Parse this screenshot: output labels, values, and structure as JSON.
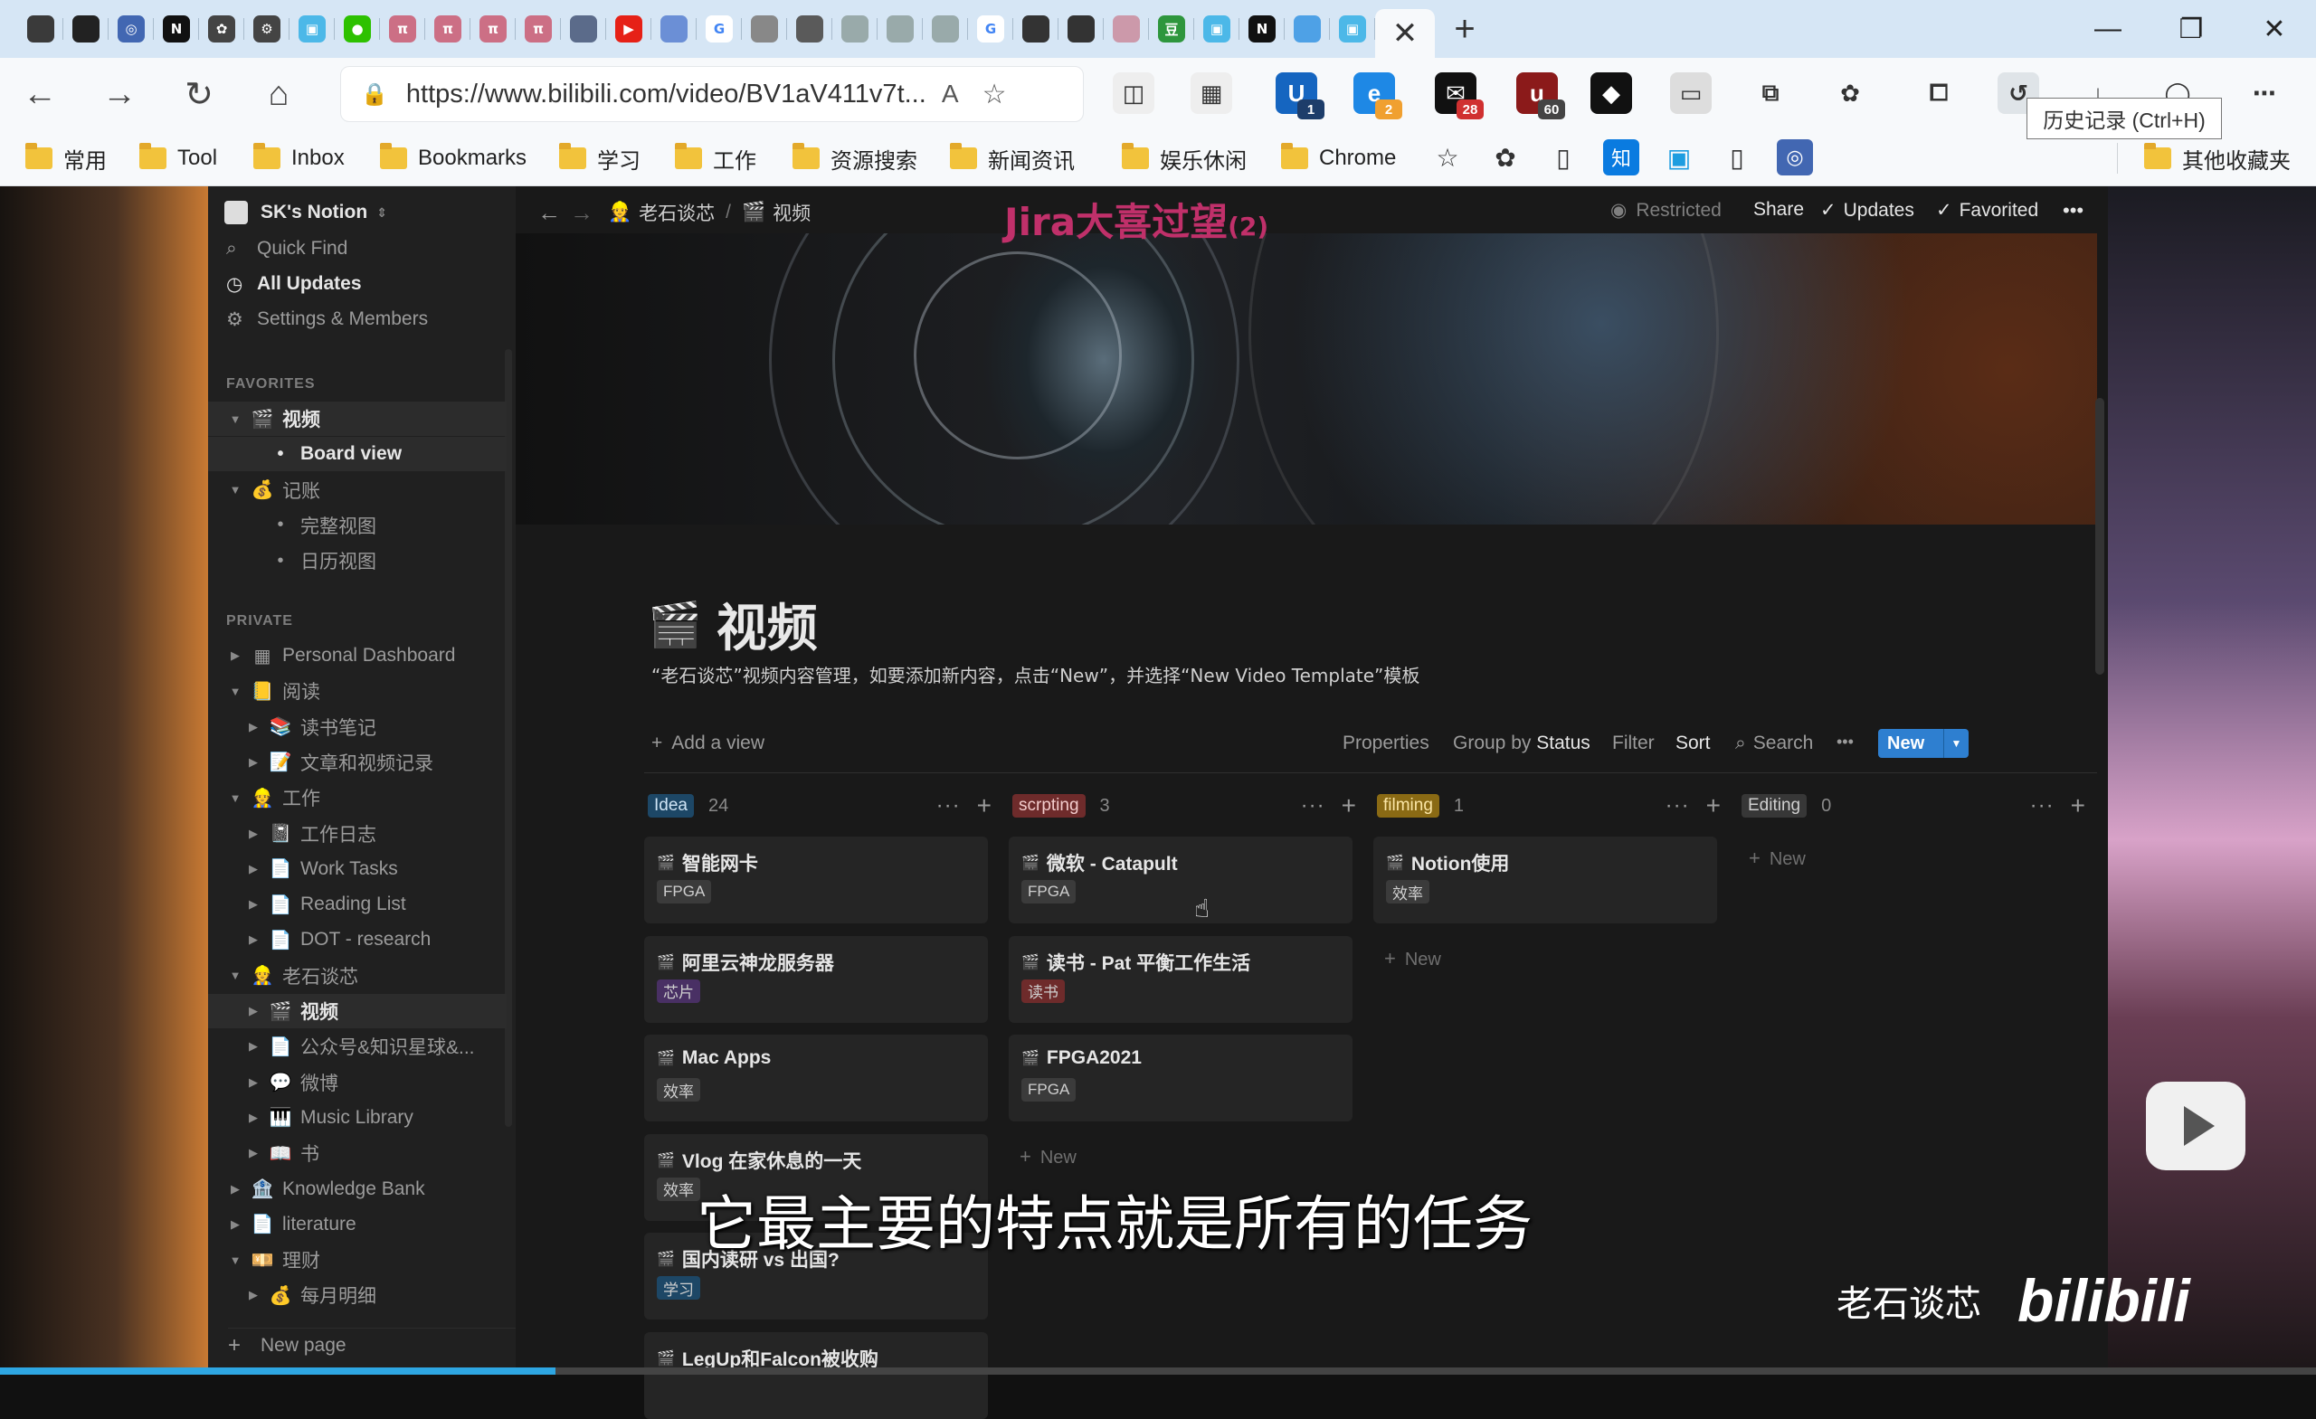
{
  "browser": {
    "url": "https://www.bilibili.com/video/BV1aV411v7t...",
    "tooltip": "历史记录 (Ctrl+H)",
    "read_aloud_label": "A",
    "extension_badges": {
      "bookmark": "1",
      "edge": "2",
      "mail": "28",
      "ublock": "60"
    },
    "bookmarks": [
      "常用",
      "Tool",
      "Inbox",
      "Bookmarks",
      "学习",
      "工作",
      "资源搜索",
      "新闻资讯",
      "娱乐休闲",
      "Chrome"
    ],
    "other_bookmarks": "其他收藏夹",
    "tab_icons": [
      "sidebar-icon",
      "mixer-icon",
      "rss-icon",
      "notion-icon",
      "gear-icon",
      "settings-icon",
      "bilibili-icon",
      "wechat-icon",
      "pi-icon",
      "pi-icon",
      "pi-icon",
      "pi-icon",
      "paw-icon",
      "youtube-icon",
      "translate-icon",
      "google-icon",
      "book-icon",
      "tools-icon",
      "chat-icon",
      "chat-icon",
      "chat-icon",
      "google-icon",
      "ifttt-icon",
      "ifttt-icon",
      "pic-icon",
      "douban-icon",
      "bilibili-icon",
      "notion-icon",
      "cloud-icon",
      "bilibili-icon"
    ]
  },
  "notion": {
    "workspace": "SK's Notion",
    "quick_find": "Quick Find",
    "all_updates": "All Updates",
    "settings": "Settings & Members",
    "favorites_label": "FAVORITES",
    "private_label": "PRIVATE",
    "favorites": [
      {
        "label": "视频",
        "emoji": "🎬",
        "level": 0,
        "caret": "▼",
        "bold": true
      },
      {
        "label": "Board view",
        "emoji": "•",
        "level": 1,
        "caret": "",
        "bold": true
      },
      {
        "label": "记账",
        "emoji": "💰",
        "level": 0,
        "caret": "▼"
      },
      {
        "label": "完整视图",
        "emoji": "•",
        "level": 1,
        "caret": ""
      },
      {
        "label": "日历视图",
        "emoji": "•",
        "level": 1,
        "caret": ""
      }
    ],
    "private": [
      {
        "label": "Personal Dashboard",
        "emoji": "▦",
        "level": 0,
        "caret": "▶"
      },
      {
        "label": "阅读",
        "emoji": "📒",
        "level": 0,
        "caret": "▼"
      },
      {
        "label": "读书笔记",
        "emoji": "📚",
        "level": 1,
        "caret": "▶"
      },
      {
        "label": "文章和视频记录",
        "emoji": "📝",
        "level": 1,
        "caret": "▶"
      },
      {
        "label": "工作",
        "emoji": "👷",
        "level": 0,
        "caret": "▼"
      },
      {
        "label": "工作日志",
        "emoji": "📓",
        "level": 1,
        "caret": "▶"
      },
      {
        "label": "Work Tasks",
        "emoji": "📄",
        "level": 1,
        "caret": "▶"
      },
      {
        "label": "Reading List",
        "emoji": "📄",
        "level": 1,
        "caret": "▶"
      },
      {
        "label": "DOT - research",
        "emoji": "📄",
        "level": 1,
        "caret": "▶"
      },
      {
        "label": "老石谈芯",
        "emoji": "👷",
        "level": 0,
        "caret": "▼"
      },
      {
        "label": "视频",
        "emoji": "🎬",
        "level": 1,
        "caret": "▶",
        "selected": true
      },
      {
        "label": "公众号&知识星球&...",
        "emoji": "📄",
        "level": 1,
        "caret": "▶"
      },
      {
        "label": "微博",
        "emoji": "💬",
        "level": 1,
        "caret": "▶"
      },
      {
        "label": "Music Library",
        "emoji": "🎹",
        "level": 1,
        "caret": "▶"
      },
      {
        "label": "书",
        "emoji": "📖",
        "level": 1,
        "caret": "▶"
      },
      {
        "label": "Knowledge Bank",
        "emoji": "🏦",
        "level": 0,
        "caret": "▶"
      },
      {
        "label": "literature",
        "emoji": "📄",
        "level": 0,
        "caret": "▶"
      },
      {
        "label": "理财",
        "emoji": "💴",
        "level": 0,
        "caret": "▼"
      },
      {
        "label": "每月明细",
        "emoji": "💰",
        "level": 1,
        "caret": "▶"
      }
    ],
    "new_page": "New page",
    "breadcrumb": [
      {
        "emoji": "👷",
        "label": "老石谈芯"
      },
      {
        "emoji": "🎬",
        "label": "视频"
      }
    ],
    "breadcrumb_sep": "/",
    "topbar": {
      "restricted": "Restricted",
      "share": "Share",
      "updates": "Updates",
      "favorited": "Favorited",
      "more": "•••"
    },
    "page_title": "视频",
    "page_emoji": "🎬",
    "description": "“老石谈芯”视频内容管理，如要添加新内容，点击“New”，并选择“New Video Template”模板",
    "toolbar": {
      "add_view": "Add a view",
      "properties": "Properties",
      "group_by": "Group by",
      "group_value": "Status",
      "filter": "Filter",
      "sort": "Sort",
      "search": "Search",
      "more": "•••",
      "new": "New"
    },
    "new_label": "New",
    "columns": [
      {
        "name": "Idea",
        "count": "24",
        "bg": "#1d4766",
        "fg": "#cfe4f5",
        "cards": [
          {
            "title": "智能网卡",
            "tag": "FPGA",
            "tag_bg": "#3b3b3b"
          },
          {
            "title": "阿里云神龙服务器",
            "tag": "芯片",
            "tag_bg": "#493064"
          },
          {
            "title": "Mac Apps",
            "tag": "效率",
            "tag_bg": "#3b3b3b"
          },
          {
            "title": "Vlog 在家休息的一天",
            "tag": "效率",
            "tag_bg": "#3b3b3b"
          },
          {
            "title": "国内读研 vs 出国?",
            "tag": "学习",
            "tag_bg": "#1d4766"
          },
          {
            "title": "LegUp和Falcon被收购",
            "tag": "",
            "tag_bg": "#3b3b3b"
          }
        ]
      },
      {
        "name": "scrpting",
        "count": "3",
        "bg": "#6e2b2b",
        "fg": "#f2cccc",
        "cards": [
          {
            "title": "微软 - Catapult",
            "tag": "FPGA",
            "tag_bg": "#3b3b3b"
          },
          {
            "title": "读书 - Pat 平衡工作生活",
            "tag": "读书",
            "tag_bg": "#6e2b2b"
          },
          {
            "title": "FPGA2021",
            "tag": "FPGA",
            "tag_bg": "#3b3b3b"
          }
        ]
      },
      {
        "name": "filming",
        "count": "1",
        "bg": "#8a6a14",
        "fg": "#fbe6a6",
        "cards": [
          {
            "title": "Notion使用",
            "tag": "效率",
            "tag_bg": "#3b3b3b"
          }
        ]
      },
      {
        "name": "Editing",
        "count": "0",
        "bg": "#373737",
        "fg": "#cfcfcf",
        "cards": []
      }
    ]
  },
  "video": {
    "subtitle": "它最主要的特点就是所有的任务",
    "overlay_title": "Jira大喜过望",
    "overlay_count": "(2)",
    "watermark": "老石谈芯",
    "watermark_logo": "bilibili",
    "progress": 0.24
  }
}
